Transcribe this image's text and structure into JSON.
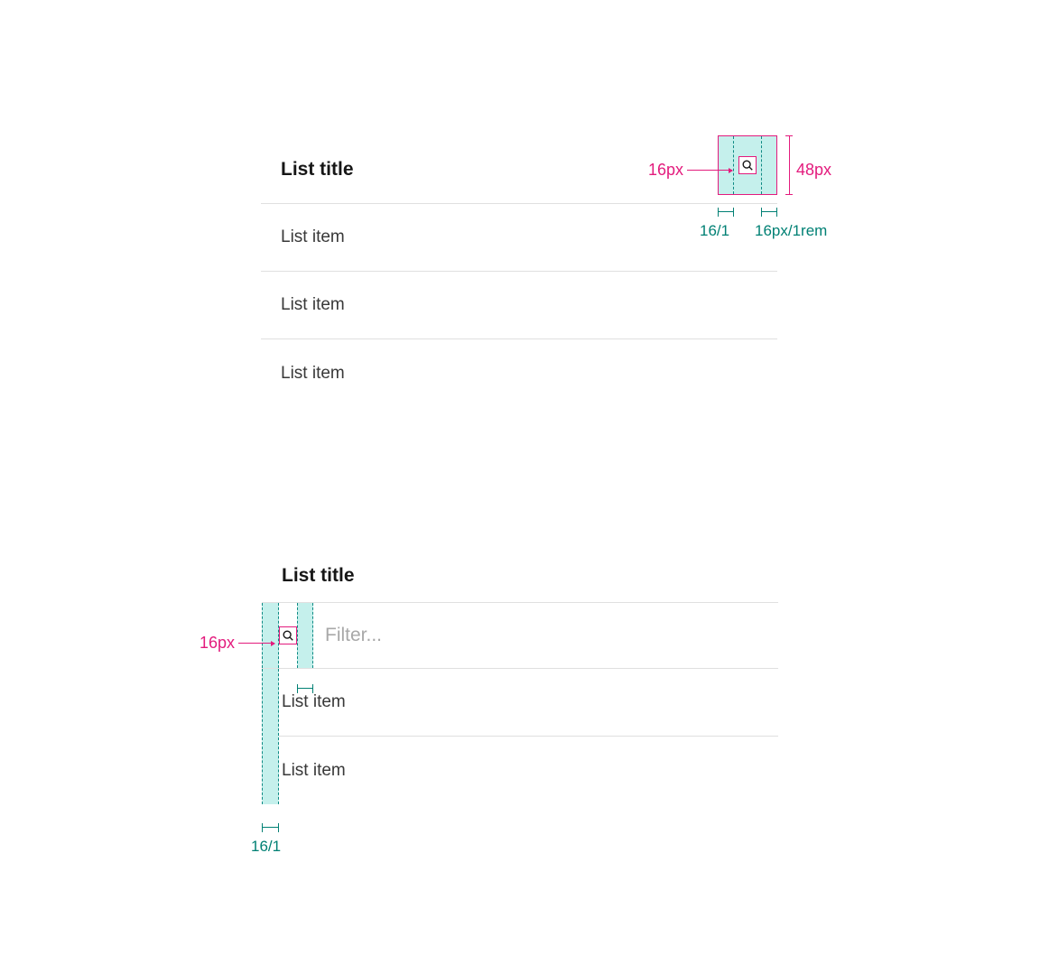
{
  "colors": {
    "magenta": "#e31b7d",
    "teal": "#008074",
    "teal_tint": "#c5f0ec",
    "divider": "#e0e0e0",
    "text": "#161616",
    "item_text": "#383838",
    "placeholder": "#a8a8a8"
  },
  "example_a": {
    "title": "List title",
    "items": [
      "List item",
      "List item",
      "List item"
    ],
    "search_button_size": "48px",
    "icon_size_label": "16px",
    "padding_labels": {
      "left": "16/1",
      "right": "16px/1rem"
    }
  },
  "example_b": {
    "title": "List title",
    "filter_placeholder": "Filter...",
    "icon_size_label": "16px",
    "items": [
      "List item",
      "List item"
    ],
    "left_padding_label": "16/1"
  }
}
